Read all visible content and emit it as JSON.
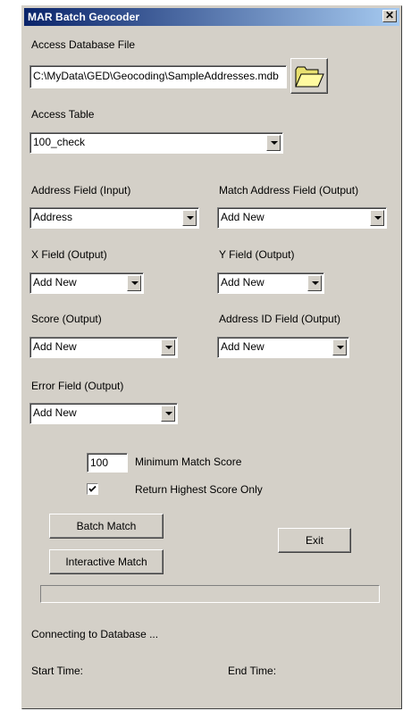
{
  "window": {
    "title": "MAR Batch Geocoder",
    "close_glyph": "✕"
  },
  "access_db": {
    "label": "Access Database File",
    "value": "C:\\MyData\\GED\\Geocoding\\SampleAddresses.mdb"
  },
  "access_table": {
    "label": "Access Table",
    "value": "100_check"
  },
  "address_field": {
    "label": "Address Field (Input)",
    "value": "Address"
  },
  "match_address_field": {
    "label": "Match Address Field (Output)",
    "value": "Add New"
  },
  "x_field": {
    "label": "X Field (Output)",
    "value": "Add New"
  },
  "y_field": {
    "label": "Y Field (Output)",
    "value": "Add New"
  },
  "score": {
    "label": "Score (Output)",
    "value": "Add New"
  },
  "address_id_field": {
    "label": "Address ID Field (Output)",
    "value": "Add New"
  },
  "error_field": {
    "label": "Error Field (Output)",
    "value": "Add New"
  },
  "min_match": {
    "label": "Minimum Match Score",
    "value": "100"
  },
  "highest_only": {
    "label": "Return Highest Score Only",
    "checked": true
  },
  "buttons": {
    "batch": "Batch Match",
    "interactive": "Interactive Match",
    "exit": "Exit"
  },
  "progress": {
    "fraction": 0
  },
  "status": {
    "message": "Connecting to Database ...",
    "start_label": "Start Time:",
    "end_label": "End Time:"
  },
  "icons": {
    "folder": "folder-open-icon",
    "check": "checkmark-icon"
  },
  "colors": {
    "title_start": "#0a246a",
    "title_end": "#a6caf0",
    "face": "#d4d0c8"
  }
}
